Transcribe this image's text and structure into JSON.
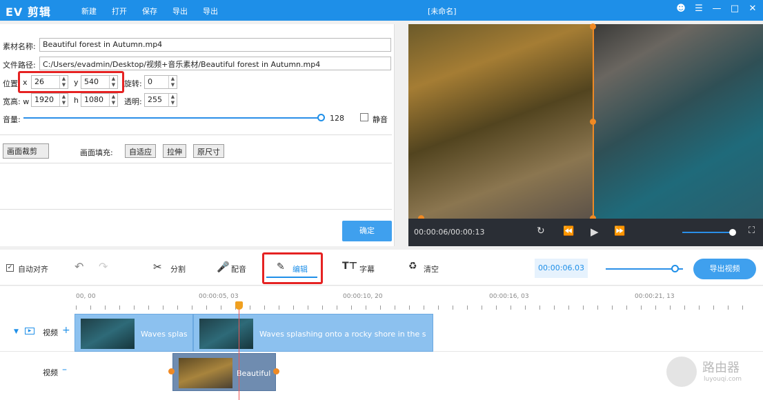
{
  "app": {
    "logo": "EV 剪辑",
    "window_title": "[未命名]",
    "menu": [
      "新建",
      "打开",
      "保存",
      "导出",
      "导出"
    ]
  },
  "props": {
    "name_label": "素材名称:",
    "name_value": "Beautiful forest in Autumn.mp4",
    "path_label": "文件路径:",
    "path_value": "C:/Users/evadmin/Desktop/视频+音乐素材/Beautiful forest in Autumn.mp4",
    "pos_label": "位置:",
    "x_label": "x",
    "x_value": "26",
    "y_label": "y",
    "y_value": "540",
    "rotate_label": "旋转:",
    "rotate_value": "0",
    "size_label": "宽高: w",
    "w_value": "1920",
    "h_label": "h",
    "h_value": "1080",
    "opacity_label": "透明:",
    "opacity_value": "255",
    "volume_label": "音量:",
    "volume_value": "128",
    "volume_fraction": 1.0,
    "mute_label": "静音",
    "crop_button": "画面裁剪",
    "fill_label": "画面填充:",
    "fill_options": [
      "自适应",
      "拉伸",
      "原尺寸"
    ],
    "confirm_button": "确定"
  },
  "preview": {
    "time": "00:00:06/00:00:13",
    "volume_fraction": 0.9
  },
  "toolbar": {
    "auto_align": "自动对齐",
    "split": "分割",
    "dub": "配音",
    "edit": "编辑",
    "subtitle": "字幕",
    "clear": "清空",
    "timecode": "00:00:06.03",
    "zoom_fraction": 0.85,
    "export": "导出视频"
  },
  "timeline": {
    "ticks": [
      "00, 00",
      "00:00:05, 03",
      "00:00:10, 20",
      "00:00:16, 03",
      "00:00:21, 13"
    ],
    "track1_label": "视频",
    "track2_label": "视频",
    "clip1_text": "Waves splas",
    "clip2_text": "Waves splashing onto a rocky shore in the s",
    "clip3_text": "Beautiful"
  },
  "watermark": {
    "name": "路由器",
    "url": "luyouqi.com"
  },
  "colors": {
    "accent": "#1e8fe8",
    "highlight": "#e52222",
    "playhead": "#f0a020",
    "clip": "#8cc1ef"
  }
}
